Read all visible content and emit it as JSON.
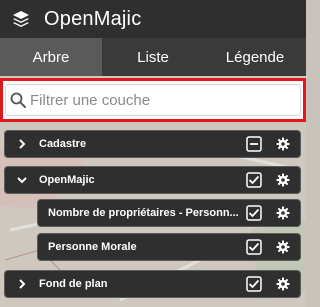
{
  "header": {
    "title": "OpenMajic",
    "icon": "layers-icon"
  },
  "tabs": [
    {
      "label": "Arbre",
      "active": true
    },
    {
      "label": "Liste",
      "active": false
    },
    {
      "label": "Légende",
      "active": false
    }
  ],
  "search": {
    "placeholder": "Filtrer une couche",
    "value": ""
  },
  "layers": [
    {
      "label": "Cadastre",
      "state": "indeterminate",
      "expanded": false
    },
    {
      "label": "OpenMajic",
      "state": "checked",
      "expanded": true,
      "children": [
        {
          "label": "Nombre de propriétaires - Personn...",
          "state": "checked"
        },
        {
          "label": "Personne Morale",
          "state": "checked"
        }
      ]
    },
    {
      "label": "Fond de plan",
      "state": "checked",
      "expanded": false
    }
  ],
  "colors": {
    "header_bg": "#2f2f2f",
    "tab_active_bg": "#5a5a5a",
    "search_highlight": "#e0191e",
    "row_bg": "#2f2f2f"
  }
}
